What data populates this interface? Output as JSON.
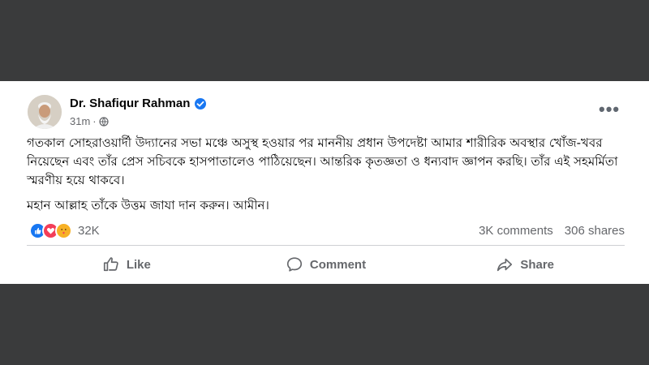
{
  "post": {
    "author": "Dr. Shafiqur Rahman",
    "time": "31m",
    "separator": "·",
    "visibility_icon": "globe-icon",
    "paragraphs": [
      "গতকাল সোহরাওয়ার্দী উদ্যানের সভা মঞ্চে অসুস্থ হওয়ার পর মাননীয় প্রধান উপদেষ্টা আমার শারীরিক অবস্থার খোঁজ-খবর নিয়েছেন এবং তাঁর প্রেস সচিবকে হাসপাতালেও পাঠিয়েছেন। আন্তরিক কৃতজ্ঞতা ও ধন্যবাদ জ্ঞাপন করছি। তাঁর এই সহমর্মিতা স্মরণীয় হয়ে থাকবে।",
      "মহান আল্লাহ তাঁকে উত্তম জাযা দান করুন। আমীন।"
    ]
  },
  "engagement": {
    "reaction_count": "32K",
    "comments": "3K comments",
    "shares": "306 shares"
  },
  "actions": {
    "like": "Like",
    "comment": "Comment",
    "share": "Share"
  },
  "colors": {
    "brand_blue": "#1877f2",
    "love_red": "#f33e58",
    "care_yellow": "#f7b125",
    "muted_text": "#65676b",
    "background_band": "#3a3b3c"
  }
}
